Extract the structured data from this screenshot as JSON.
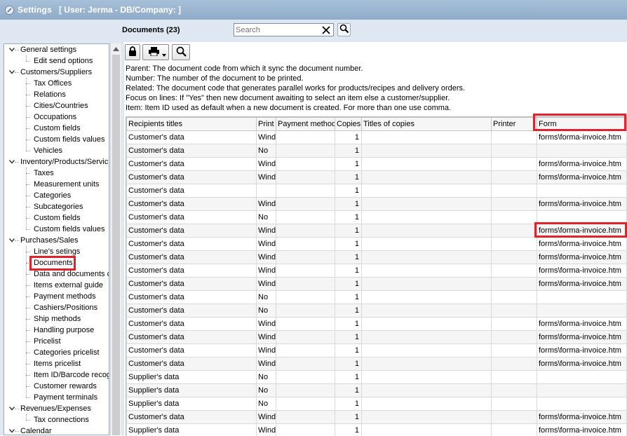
{
  "window": {
    "title": "Settings",
    "user_info": "[ User: Jerma - DB/Company:  ]"
  },
  "header": {
    "documents_title": "Documents (23)",
    "search_placeholder": "Search"
  },
  "tree": {
    "items": [
      {
        "label": "General settings",
        "level": 0,
        "expanded": true
      },
      {
        "label": "Edit send options",
        "level": 1
      },
      {
        "label": "Customers/Suppliers",
        "level": 0,
        "expanded": true
      },
      {
        "label": "Tax Offices",
        "level": 1
      },
      {
        "label": "Relations",
        "level": 1
      },
      {
        "label": "Cities/Countries",
        "level": 1
      },
      {
        "label": "Occupations",
        "level": 1
      },
      {
        "label": "Custom fields",
        "level": 1
      },
      {
        "label": "Custom fields values",
        "level": 1
      },
      {
        "label": "Vehicles",
        "level": 1
      },
      {
        "label": "Inventory/Products/Servic",
        "level": 0,
        "expanded": true
      },
      {
        "label": "Taxes",
        "level": 1
      },
      {
        "label": "Measurement units",
        "level": 1
      },
      {
        "label": "Categories",
        "level": 1
      },
      {
        "label": "Subcategories",
        "level": 1
      },
      {
        "label": "Custom fields",
        "level": 1
      },
      {
        "label": "Custom fields values",
        "level": 1
      },
      {
        "label": "Purchases/Sales",
        "level": 0,
        "expanded": true
      },
      {
        "label": "Line's setings",
        "level": 1
      },
      {
        "label": "Documents",
        "level": 1,
        "selected": true
      },
      {
        "label": "Data and documents c",
        "level": 1
      },
      {
        "label": "Items external guide",
        "level": 1
      },
      {
        "label": "Payment methods",
        "level": 1
      },
      {
        "label": "Cashiers/Positions",
        "level": 1
      },
      {
        "label": "Ship methods",
        "level": 1
      },
      {
        "label": "Handling purpose",
        "level": 1
      },
      {
        "label": "Pricelist",
        "level": 1
      },
      {
        "label": "Categories pricelist",
        "level": 1
      },
      {
        "label": "Items pricelist",
        "level": 1
      },
      {
        "label": "Item ID/Barcode recog",
        "level": 1
      },
      {
        "label": "Customer rewards",
        "level": 1
      },
      {
        "label": "Payment terminals",
        "level": 1
      },
      {
        "label": "Revenues/Expenses",
        "level": 0,
        "expanded": true
      },
      {
        "label": "Tax connections",
        "level": 1
      },
      {
        "label": "Calendar",
        "level": 0,
        "expanded": true
      }
    ]
  },
  "info_lines": [
    "Parent: The document code from which it sync the document number.",
    "Number: The number of the document to be printed.",
    "Related: The document code that generates parallel works for products/recipes and delivery orders.",
    "Focus on lines: If \"Yes\" then new document awaiting to select an item else a customer/supplier.",
    "Item: Item ID used as default when a new document is created. For more than one use comma."
  ],
  "table": {
    "columns": [
      "Recipients titles",
      "Print",
      "Payment method",
      "Copies",
      "Titles of copies",
      "Printer",
      "Form"
    ],
    "rows": [
      [
        "Customer's data",
        "Wind",
        "",
        "1",
        "",
        "",
        "forms\\forma-invoice.htm"
      ],
      [
        "Customer's data",
        "No",
        "",
        "1",
        "",
        "",
        ""
      ],
      [
        "Customer's data",
        "Wind",
        "",
        "1",
        "",
        "",
        "forms\\forma-invoice.htm"
      ],
      [
        "Customer's data",
        "Wind",
        "",
        "1",
        "",
        "",
        "forms\\forma-invoice.htm"
      ],
      [
        "Customer's data",
        "",
        "",
        "1",
        "",
        "",
        ""
      ],
      [
        "Customer's data",
        "Wind",
        "",
        "1",
        "",
        "",
        "forms\\forma-invoice.htm"
      ],
      [
        "Customer's data",
        "No",
        "",
        "1",
        "",
        "",
        ""
      ],
      [
        "Customer's data",
        "Wind",
        "",
        "1",
        "",
        "",
        "forms\\forma-invoice.htm"
      ],
      [
        "Customer's data",
        "Wind",
        "",
        "1",
        "",
        "",
        "forms\\forma-invoice.htm"
      ],
      [
        "Customer's data",
        "Wind",
        "",
        "1",
        "",
        "",
        "forms\\forma-invoice.htm"
      ],
      [
        "Customer's data",
        "Wind",
        "",
        "1",
        "",
        "",
        "forms\\forma-invoice.htm"
      ],
      [
        "Customer's data",
        "Wind",
        "",
        "1",
        "",
        "",
        "forms\\forma-invoice.htm"
      ],
      [
        "Customer's data",
        "No",
        "",
        "1",
        "",
        "",
        ""
      ],
      [
        "Customer's data",
        "No",
        "",
        "1",
        "",
        "",
        ""
      ],
      [
        "Customer's data",
        "Wind",
        "",
        "1",
        "",
        "",
        "forms\\forma-invoice.htm"
      ],
      [
        "Customer's data",
        "Wind",
        "",
        "1",
        "",
        "",
        "forms\\forma-invoice.htm"
      ],
      [
        "Customer's data",
        "Wind",
        "",
        "1",
        "",
        "",
        "forms\\forma-invoice.htm"
      ],
      [
        "Customer's data",
        "Wind",
        "",
        "1",
        "",
        "",
        "forms\\forma-invoice.htm"
      ],
      [
        "Supplier's data",
        "No",
        "",
        "1",
        "",
        "",
        ""
      ],
      [
        "Supplier's data",
        "No",
        "",
        "1",
        "",
        "",
        ""
      ],
      [
        "Supplier's data",
        "No",
        "",
        "1",
        "",
        "",
        ""
      ],
      [
        "Customer's data",
        "Wind",
        "",
        "1",
        "",
        "",
        "forms\\forma-invoice.htm"
      ],
      [
        "Supplier's data",
        "Wind",
        "",
        "1",
        "",
        "",
        "forms\\forma-invoice.htm"
      ]
    ]
  },
  "colors": {
    "titlebar": "#9bb5d0",
    "pane_background": "#dfe8f2",
    "highlight_box": "#e0232b"
  }
}
